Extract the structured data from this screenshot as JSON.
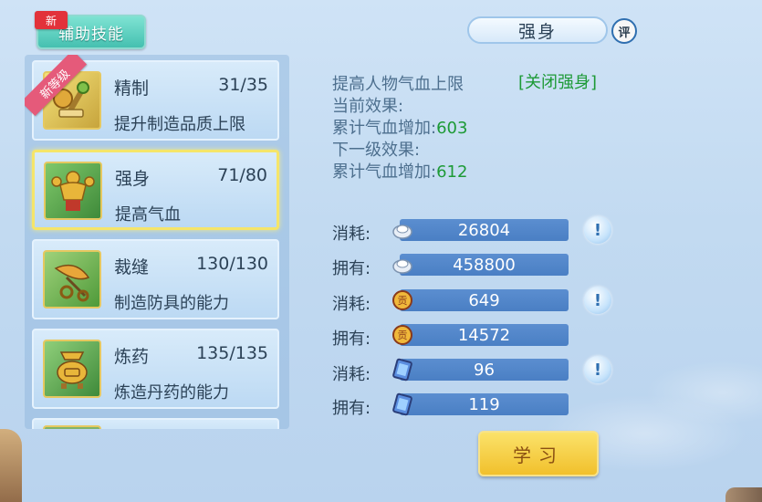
{
  "tab": {
    "label": "辅助技能",
    "new_badge": "新"
  },
  "title": "强身",
  "rate_label": "评",
  "skills": [
    {
      "name": "精制",
      "level": "31/35",
      "desc": "提升制造品质上限",
      "ribbon": "新等级",
      "icon": "crafting-tools-icon"
    },
    {
      "name": "强身",
      "level": "71/80",
      "desc": "提高气血",
      "icon": "strong-body-icon"
    },
    {
      "name": "裁缝",
      "level": "130/130",
      "desc": "制造防具的能力",
      "icon": "tailoring-scissors-icon"
    },
    {
      "name": "炼药",
      "level": "135/135",
      "desc": "炼造丹药的能力",
      "icon": "alchemy-cauldron-icon"
    }
  ],
  "info": {
    "description": "提高人物气血上限",
    "toggle": "[关闭强身]",
    "current_effect_label": "当前效果:",
    "current_hp_label": "累计气血增加:",
    "current_hp_value": "603",
    "next_effect_label": "下一级效果:",
    "next_hp_label": "累计气血增加:",
    "next_hp_value": "612"
  },
  "costs": [
    {
      "label": "消耗:",
      "value": "26804",
      "icon": "silver-icon",
      "info": true
    },
    {
      "label": "拥有:",
      "value": "458800",
      "icon": "silver-icon",
      "info": false
    },
    {
      "label": "消耗:",
      "value": "649",
      "icon": "contribution-icon",
      "info": true
    },
    {
      "label": "拥有:",
      "value": "14572",
      "icon": "contribution-icon",
      "info": false
    },
    {
      "label": "消耗:",
      "value": "96",
      "icon": "book-icon",
      "info": true
    },
    {
      "label": "拥有:",
      "value": "119",
      "icon": "book-icon",
      "info": false
    }
  ],
  "learn_button": "学习",
  "colors": {
    "accent_green": "#1d9a36",
    "bar_blue": "#4a7fc4",
    "button_gold": "#f1c02c",
    "tab_teal": "#45c0b0"
  }
}
